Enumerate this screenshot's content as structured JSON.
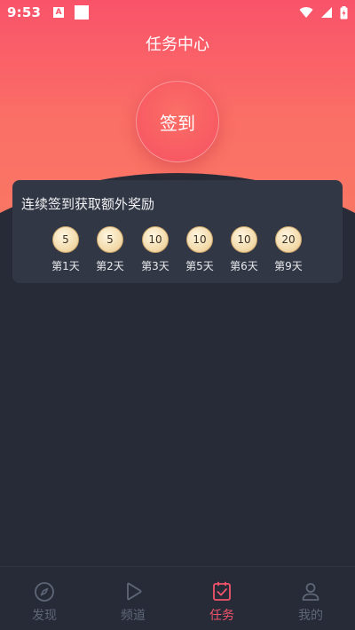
{
  "status_bar": {
    "time": "9:53",
    "notif_label": "A"
  },
  "header": {
    "title": "任务中心"
  },
  "checkin": {
    "label": "签到"
  },
  "bonus": {
    "title": "连续签到获取额外奖励",
    "rewards": [
      {
        "value": "5",
        "day": "第1天"
      },
      {
        "value": "5",
        "day": "第2天"
      },
      {
        "value": "10",
        "day": "第3天"
      },
      {
        "value": "10",
        "day": "第5天"
      },
      {
        "value": "10",
        "day": "第6天"
      },
      {
        "value": "20",
        "day": "第9天"
      }
    ]
  },
  "nav": {
    "items": [
      {
        "label": "发现",
        "icon": "compass-icon"
      },
      {
        "label": "频道",
        "icon": "play-icon"
      },
      {
        "label": "任务",
        "icon": "task-check-icon"
      },
      {
        "label": "我的",
        "icon": "user-icon"
      }
    ],
    "active_index": 2
  },
  "colors": {
    "accent": "#f2546b",
    "hero_top": "#f9536a",
    "hero_bottom": "#f97a63",
    "background": "#262b37",
    "card": "#313744",
    "coin": "#f3dcae",
    "nav_inactive": "#5f6677"
  }
}
